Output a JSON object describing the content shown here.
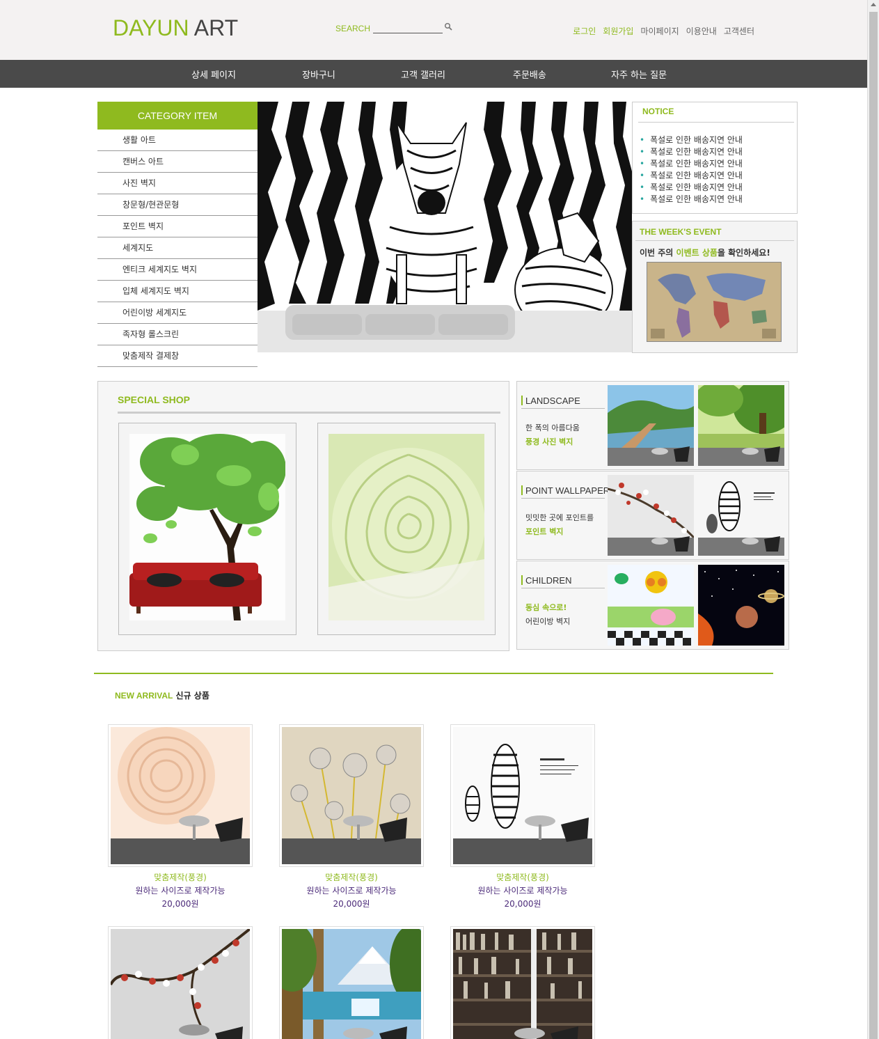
{
  "header": {
    "logo_part1": "DAYUN",
    "logo_part2": "ART",
    "search_label": "SEARCH",
    "search_value": "",
    "util_links": [
      "로그인",
      "회원가입",
      "마이페이지",
      "이용안내",
      "고객센터"
    ]
  },
  "nav": {
    "items": [
      "상세 페이지",
      "장바구니",
      "고객 갤러리",
      "주문배송",
      "자주 하는 질문"
    ]
  },
  "category": {
    "title": "CATEGORY ITEM",
    "items": [
      "생활 아트",
      "캔버스 아트",
      "사진 벽지",
      "창문형/현관문형",
      "포인트 벽지",
      "세계지도",
      "엔티크 세계지도 벽지",
      "입체 세계지도 벽지",
      "어린이방 세계지도",
      "족자형 롤스크린",
      "맞춤제작 결제창"
    ]
  },
  "notice": {
    "title": "NOTICE",
    "bullet": "•",
    "items": [
      "폭설로 인한 배송지연 안내",
      "폭설로 인한 배송지연 안내",
      "폭설로 인한 배송지연 안내",
      "폭설로 인한 배송지연 안내",
      "폭설로 인한 배송지연 안내",
      "폭설로 인한 배송지연 안내"
    ]
  },
  "event": {
    "title": "THE WEEK'S EVENT",
    "text_pre": "이번 주의 ",
    "text_highlight": "이벤트 상품",
    "text_post": "을 확인하세요!"
  },
  "special_shop": {
    "title": "SPECIAL SHOP"
  },
  "side_categories": [
    {
      "title": "LANDSCAPE",
      "line1": "한 폭의 아름다움",
      "line2": "풍경 사진 벽지"
    },
    {
      "title": "POINT WALLPAPER",
      "line1": "밋밋한 곳에 포인트를",
      "line2": "포인트 벽지"
    },
    {
      "title": "CHILDREN",
      "line1": "동심 속으로!",
      "line2": "어린이방 벽지"
    }
  ],
  "new_arrival": {
    "title_en": "NEW ARRIVAL",
    "title_ko": "신규 상품",
    "products": [
      {
        "name": "맞춤제작(풍경)",
        "desc": "원하는 사이즈로 제작가능",
        "price": "20,000원"
      },
      {
        "name": "맞춤제작(풍경)",
        "desc": "원하는 사이즈로 제작가능",
        "price": "20,000원"
      },
      {
        "name": "맞춤제작(풍경)",
        "desc": "원하는 사이즈로 제작가능",
        "price": "20,000원"
      }
    ]
  },
  "colors": {
    "accent": "#8fba1f",
    "nav_bg": "#4a4a4a",
    "header_bg": "#f4f2f2",
    "price_text": "#4b2a79"
  }
}
